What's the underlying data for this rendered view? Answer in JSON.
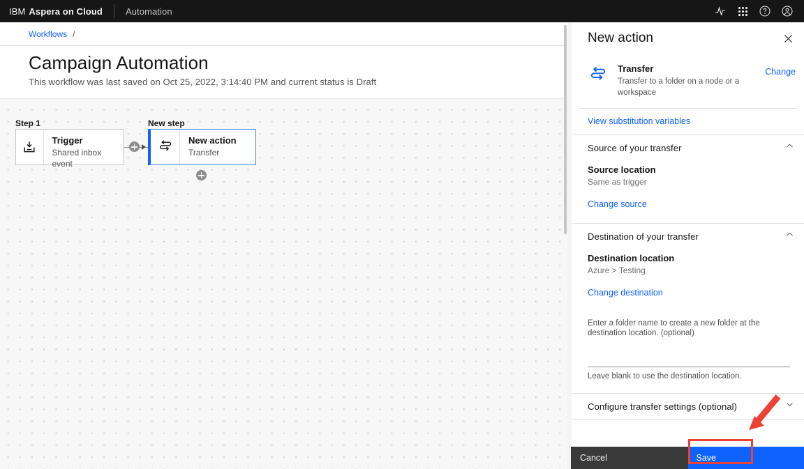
{
  "topbar": {
    "brand_ibm": "IBM",
    "brand_product": "Aspera on Cloud",
    "nav_item": "Automation",
    "icons": {
      "activity": "activity-pulse-icon",
      "switcher": "app-switcher-icon",
      "help": "help-circle-icon",
      "account": "user-avatar-icon"
    }
  },
  "breadcrumb": {
    "link": "Workflows",
    "separator": "/"
  },
  "page": {
    "title": "Campaign Automation",
    "subtitle": "This workflow was last saved on Oct 25, 2022, 3:14:40 PM and current status is Draft"
  },
  "canvas": {
    "step_label": "Step 1",
    "new_step_label": "New step",
    "trigger_card": {
      "title": "Trigger",
      "subtitle": "Shared inbox event",
      "icon": "inbox-download-icon"
    },
    "action_card": {
      "title": "New action",
      "subtitle": "Transfer",
      "icon": "transfer-icon"
    },
    "add_between_label": "+",
    "add_below_label": "+"
  },
  "panel": {
    "title": "New action",
    "close_icon": "close-icon",
    "action": {
      "icon": "transfer-icon",
      "name": "Transfer",
      "description": "Transfer to a folder on a node or a workspace",
      "change_label": "Change"
    },
    "substitution_link": "View substitution variables",
    "source_section": {
      "heading": "Source of your transfer",
      "field_label": "Source location",
      "field_value": "Same as trigger",
      "change_link": "Change source",
      "expanded": true
    },
    "destination_section": {
      "heading": "Destination of your transfer",
      "field_label": "Destination location",
      "field_value": "Azure > Testing",
      "change_link": "Change destination",
      "helper_top": "Enter a folder name to create a new folder at the destination location. (optional)",
      "input_value": "",
      "input_placeholder": "",
      "helper_bottom": "Leave blank to use the destination location.",
      "expanded": true
    },
    "settings_section": {
      "heading": "Configure transfer settings (optional)",
      "expanded": false
    }
  },
  "footer": {
    "cancel_label": "Cancel",
    "save_label": "Save"
  },
  "colors": {
    "accent_blue": "#0f62fe",
    "dark_bar": "#161616",
    "cancel_grey": "#393939",
    "annotation_red": "#ee4136"
  }
}
